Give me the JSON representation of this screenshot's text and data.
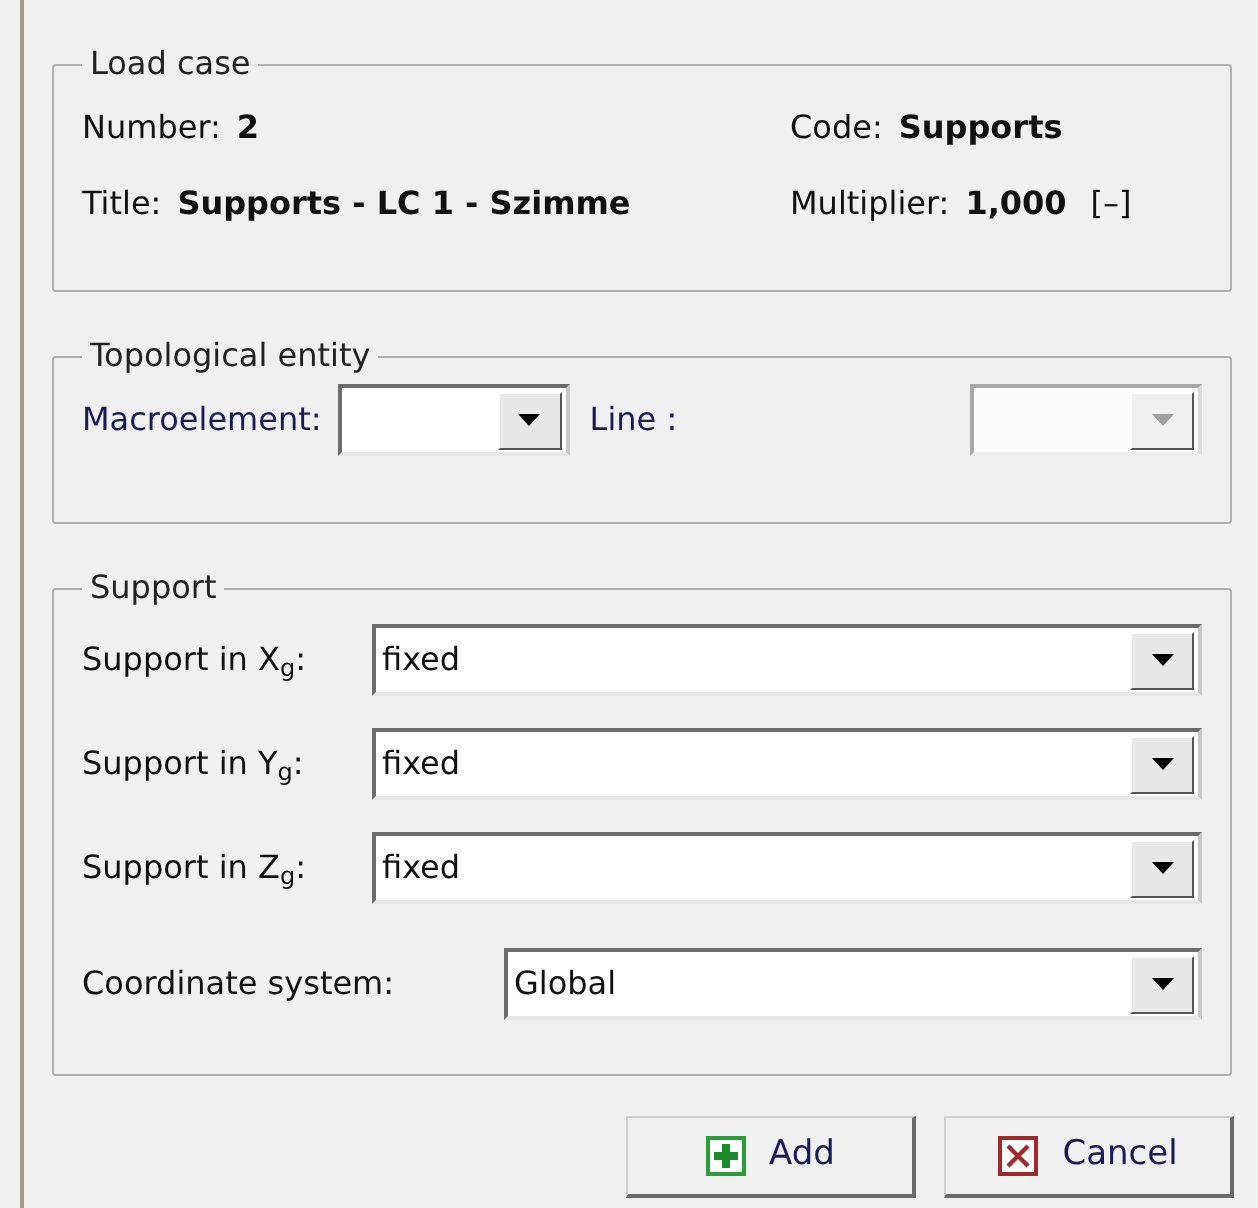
{
  "load_case": {
    "title": "Load case",
    "fields": [
      {
        "label": "Number:",
        "value": "2"
      },
      {
        "label": "Code:",
        "value": "Supports"
      },
      {
        "label": "Title:",
        "value": "Supports - LC 1 - Szimme"
      },
      {
        "label": "Multiplier:",
        "value": "1,000",
        "unit": "[–]"
      }
    ]
  },
  "topological_entity": {
    "title": "Topological entity",
    "dropdowns": [
      {
        "label": "Macroelement:",
        "disabled": false
      },
      {
        "label": "Line :",
        "disabled": true
      }
    ]
  },
  "support": {
    "title": "Support",
    "dropdowns": [
      {
        "label": "Support in X$_{g}$:",
        "value": "fixed"
      },
      {
        "label": "Support in Y$_{g}$:",
        "value": "fixed"
      },
      {
        "label": "Support in Z$_{g}$:",
        "value": "fixed"
      },
      {
        "label": "Coordinate system:",
        "value": "Global"
      }
    ]
  },
  "buttons": [
    {
      "kind": "add",
      "label": "Add"
    },
    {
      "kind": "cancel",
      "label": "Cancel"
    }
  ]
}
